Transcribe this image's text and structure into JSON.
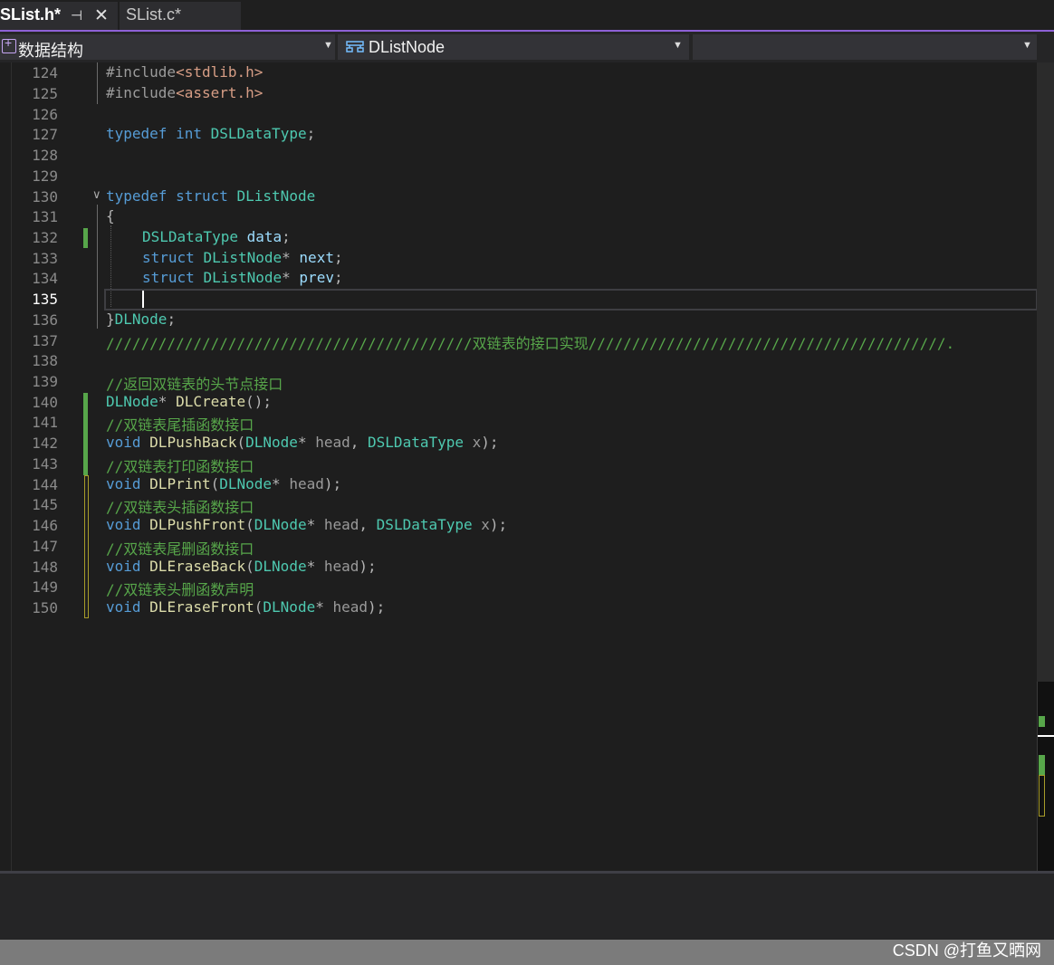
{
  "tabs": [
    {
      "label": "SList.h*",
      "active": true
    },
    {
      "label": "SList.c*",
      "active": false
    }
  ],
  "nav": {
    "project": "数据结构",
    "type": "DListNode",
    "member": ""
  },
  "editor": {
    "current_line": "135",
    "line_numbers": [
      "124",
      "125",
      "126",
      "127",
      "128",
      "129",
      "130",
      "131",
      "132",
      "133",
      "134",
      "135",
      "136",
      "137",
      "138",
      "139",
      "140",
      "141",
      "142",
      "143",
      "144",
      "145",
      "146",
      "147",
      "148",
      "149",
      "150"
    ],
    "code": {
      "l124": {
        "pp": "#include",
        "str": "<stdlib.h>"
      },
      "l125": {
        "pp": "#include",
        "str": "<assert.h>"
      },
      "l127": {
        "kw1": "typedef",
        "kw2": "int",
        "type": "DSLDataType",
        "punct": ";"
      },
      "l130": {
        "kw1": "typedef",
        "kw2": "struct",
        "type": "DListNode"
      },
      "l131": {
        "brace": "{"
      },
      "l132": {
        "type": "DSLDataType",
        "field": "data",
        "punct": ";"
      },
      "l133": {
        "kw": "struct",
        "type": "DListNode",
        "star": "*",
        "field": "next",
        "punct": ";"
      },
      "l134": {
        "kw": "struct",
        "type": "DListNode",
        "star": "*",
        "field": "prev",
        "punct": ";"
      },
      "l136": {
        "brace": "}",
        "type": "DLNode",
        "punct": ";"
      },
      "l137": {
        "comment": "//////////////////////////////////////////双链表的接口实现/////////////////////////////////////////."
      },
      "l139": {
        "comment": "//返回双链表的头节点接口"
      },
      "l140": {
        "type": "DLNode",
        "star": "*",
        "fn": "DLCreate",
        "rest": "();"
      },
      "l141": {
        "comment": "//双链表尾插函数接口"
      },
      "l142": {
        "ret": "void",
        "fn": "DLPushBack",
        "open": "(",
        "t1": "DLNode",
        "star": "*",
        "p1": "head",
        "comma": ",",
        "t2": "DSLDataType",
        "p2": "x",
        "close": ");"
      },
      "l143": {
        "comment": "//双链表打印函数接口"
      },
      "l144": {
        "ret": "void",
        "fn": "DLPrint",
        "open": "(",
        "t1": "DLNode",
        "star": "*",
        "p1": "head",
        "close": ");"
      },
      "l145": {
        "comment": "//双链表头插函数接口"
      },
      "l146": {
        "ret": "void",
        "fn": "DLPushFront",
        "open": "(",
        "t1": "DLNode",
        "star": "*",
        "p1": "head",
        "comma": ",",
        "t2": "DSLDataType",
        "p2": "x",
        "close": ");"
      },
      "l147": {
        "comment": "//双链表尾删函数接口"
      },
      "l148": {
        "ret": "void",
        "fn": "DLEraseBack",
        "open": "(",
        "t1": "DLNode",
        "star": "*",
        "p1": "head",
        "close": ");"
      },
      "l149": {
        "comment": "//双链表头删函数声明"
      },
      "l150": {
        "ret": "void",
        "fn": "DLEraseFront",
        "open": "(",
        "t1": "DLNode",
        "star": "*",
        "p1": "head",
        "close": ");"
      }
    }
  },
  "watermark": "CSDN @打鱼又晒网",
  "colors": {
    "keyword": "#569cd6",
    "type": "#4ec9b0",
    "function": "#dcdcaa",
    "field": "#9cdcfe",
    "string": "#d69d85",
    "comment": "#57a64a",
    "accent": "#8e61d6",
    "saved_change": "#57a64a",
    "unsaved_change": "#a89c2a"
  },
  "icons": [
    "pin-icon",
    "close-icon",
    "project-icon",
    "struct-icon",
    "chevron-down-icon",
    "fold-chevron-icon"
  ]
}
